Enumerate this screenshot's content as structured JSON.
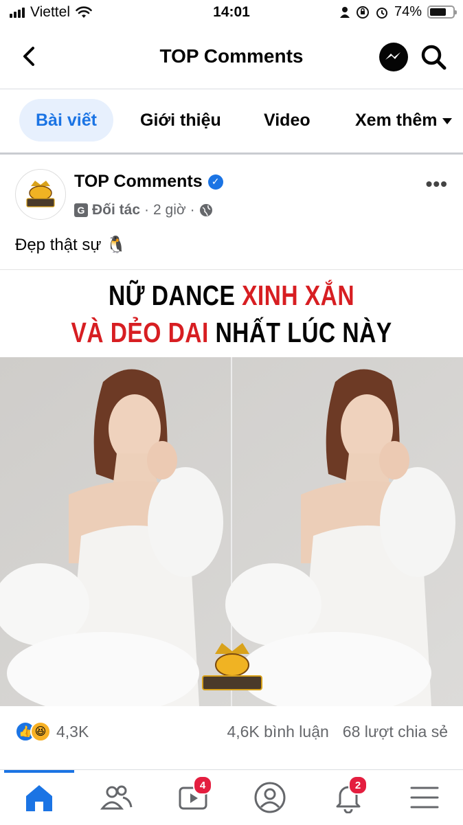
{
  "status_bar": {
    "carrier": "Viettel",
    "time": "14:01",
    "battery_percent": "74%",
    "battery_level": 0.74
  },
  "header": {
    "title": "TOP Comments",
    "back_icon": "chevron-left-icon",
    "messenger_icon": "messenger-icon",
    "search_icon": "search-icon"
  },
  "tabs": [
    {
      "label": "Bài viết",
      "active": true
    },
    {
      "label": "Giới thiệu",
      "active": false
    },
    {
      "label": "Video",
      "active": false
    },
    {
      "label": "Xem thêm",
      "active": false
    }
  ],
  "post": {
    "author": "TOP Comments",
    "verified": true,
    "partner_label": "Đối tác",
    "separator": "·",
    "time": "2 giờ",
    "caption": "Đẹp thật sự 🐧",
    "more": "•••",
    "image": {
      "headline_line1_black": "NỮ DANCE",
      "headline_line1_red": "XINH XẮN",
      "headline_line2_red": "VÀ DẺO DAI",
      "headline_line2_black": "NHẤT LÚC NÀY"
    },
    "stats": {
      "reactions_count": "4,3K",
      "comments": "4,6K bình luận",
      "shares": "68 lượt chia sẻ"
    }
  },
  "bottom_nav": {
    "items": [
      {
        "name": "home-icon",
        "active": true,
        "badge": ""
      },
      {
        "name": "friends-icon",
        "active": false,
        "badge": ""
      },
      {
        "name": "video-icon",
        "active": false,
        "badge": "4"
      },
      {
        "name": "profile-icon",
        "active": false,
        "badge": ""
      },
      {
        "name": "bell-icon",
        "active": false,
        "badge": "2"
      },
      {
        "name": "menu-icon",
        "active": false,
        "badge": ""
      }
    ]
  },
  "colors": {
    "accent": "#1b74e4",
    "headline_red": "#d71e22",
    "badge": "#e41e3f"
  }
}
